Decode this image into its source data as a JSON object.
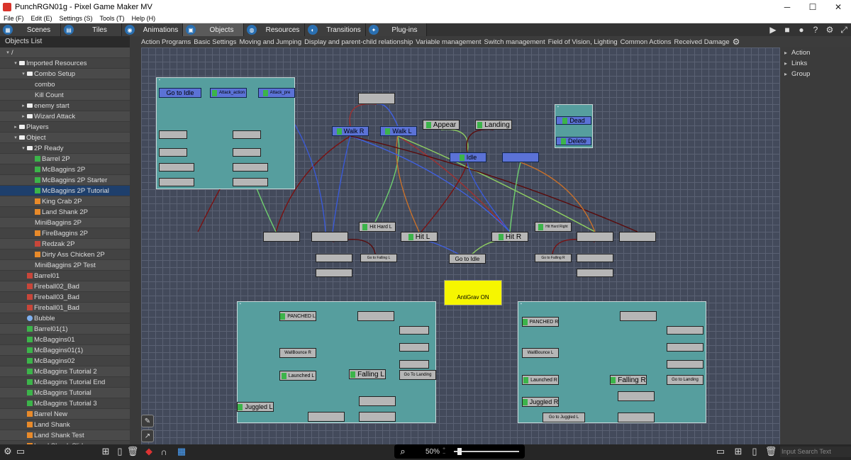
{
  "window": {
    "title": "PunchRGN01g - Pixel Game Maker MV",
    "minimize": "─",
    "maximize": "☐",
    "close": "✕"
  },
  "menu": [
    "File (F)",
    "Edit (E)",
    "Settings (S)",
    "Tools (T)",
    "Help (H)"
  ],
  "tabs": [
    {
      "label": "Scenes",
      "icon": "scenes-icon"
    },
    {
      "label": "Tiles",
      "icon": "tiles-icon"
    },
    {
      "label": "Animations",
      "icon": "animations-icon"
    },
    {
      "label": "Objects",
      "icon": "objects-icon"
    },
    {
      "label": "Resources",
      "icon": "resources-icon"
    },
    {
      "label": "Transitions",
      "icon": "transitions-icon"
    },
    {
      "label": "Plug-ins",
      "icon": "plugins-icon"
    }
  ],
  "toolbar_icons": [
    "play-icon",
    "stop-icon",
    "record-icon",
    "help-icon",
    "settings-icon",
    "fullscreen-icon"
  ],
  "objects_list": {
    "header": "Objects List",
    "items": [
      {
        "label": "/",
        "depth": 0,
        "arrow": "▾",
        "icon": "none"
      },
      {
        "label": "Imported Resources",
        "depth": 1,
        "arrow": "▾",
        "icon": "folder"
      },
      {
        "label": "Combo Setup",
        "depth": 2,
        "arrow": "▾",
        "icon": "folder"
      },
      {
        "label": "combo",
        "depth": 3,
        "arrow": "",
        "icon": "none"
      },
      {
        "label": "Kill Count",
        "depth": 3,
        "arrow": "",
        "icon": "none"
      },
      {
        "label": "enemy start",
        "depth": 2,
        "arrow": "▸",
        "icon": "folder"
      },
      {
        "label": "Wizard Attack",
        "depth": 2,
        "arrow": "▸",
        "icon": "folder"
      },
      {
        "label": "Players",
        "depth": 1,
        "arrow": "▸",
        "icon": "folder"
      },
      {
        "label": "Object",
        "depth": 1,
        "arrow": "▾",
        "icon": "folder"
      },
      {
        "label": "2P Ready",
        "depth": 2,
        "arrow": "▾",
        "icon": "folder"
      },
      {
        "label": "Barrel 2P",
        "depth": 3,
        "arrow": "",
        "icon": "green"
      },
      {
        "label": "McBaggins 2P",
        "depth": 3,
        "arrow": "",
        "icon": "green"
      },
      {
        "label": "McBaggins 2P Starter",
        "depth": 3,
        "arrow": "",
        "icon": "green"
      },
      {
        "label": "McBaggins 2P Tutorial",
        "depth": 3,
        "arrow": "",
        "icon": "green",
        "selected": true
      },
      {
        "label": "King Crab 2P",
        "depth": 3,
        "arrow": "",
        "icon": "orange"
      },
      {
        "label": "Land Shank 2P",
        "depth": 3,
        "arrow": "",
        "icon": "orange"
      },
      {
        "label": "MiniBaggins 2P",
        "depth": 3,
        "arrow": "",
        "icon": "none"
      },
      {
        "label": "FireBaggins 2P",
        "depth": 3,
        "arrow": "",
        "icon": "orange"
      },
      {
        "label": "Redzak 2P",
        "depth": 3,
        "arrow": "",
        "icon": "red"
      },
      {
        "label": "Dirty Ass Chicken 2P",
        "depth": 3,
        "arrow": "",
        "icon": "orange"
      },
      {
        "label": "MiniBaggins 2P Test",
        "depth": 3,
        "arrow": "",
        "icon": "none"
      },
      {
        "label": "Barrel01",
        "depth": 2,
        "arrow": "",
        "icon": "red"
      },
      {
        "label": "Fireball02_Bad",
        "depth": 2,
        "arrow": "",
        "icon": "red"
      },
      {
        "label": "Fireball03_Bad",
        "depth": 2,
        "arrow": "",
        "icon": "red"
      },
      {
        "label": "Fireball01_Bad",
        "depth": 2,
        "arrow": "",
        "icon": "red"
      },
      {
        "label": "Bubble",
        "depth": 2,
        "arrow": "",
        "icon": "blue"
      },
      {
        "label": "Barrel01(1)",
        "depth": 2,
        "arrow": "",
        "icon": "green"
      },
      {
        "label": "McBaggins01",
        "depth": 2,
        "arrow": "",
        "icon": "green"
      },
      {
        "label": "McBaggins01(1)",
        "depth": 2,
        "arrow": "",
        "icon": "green"
      },
      {
        "label": "McBaggins02",
        "depth": 2,
        "arrow": "",
        "icon": "green"
      },
      {
        "label": "McBaggins Tutorial 2",
        "depth": 2,
        "arrow": "",
        "icon": "green"
      },
      {
        "label": "McBaggins Tutorial End",
        "depth": 2,
        "arrow": "",
        "icon": "green"
      },
      {
        "label": "McBaggins Tutorial",
        "depth": 2,
        "arrow": "",
        "icon": "green"
      },
      {
        "label": "McBaggins Tutorial 3",
        "depth": 2,
        "arrow": "",
        "icon": "green"
      },
      {
        "label": "Barrel New",
        "depth": 2,
        "arrow": "",
        "icon": "orange"
      },
      {
        "label": "Land Shank",
        "depth": 2,
        "arrow": "",
        "icon": "orange"
      },
      {
        "label": "Land Shank Test",
        "depth": 2,
        "arrow": "",
        "icon": "orange"
      },
      {
        "label": "Land Shank Slide",
        "depth": 2,
        "arrow": "",
        "icon": "orange"
      }
    ]
  },
  "property_tabs": [
    "Action Programs",
    "Basic Settings",
    "Moving and Jumping",
    "Display and parent-child relationship",
    "Variable management",
    "Switch management",
    "Field of Vision, Lighting",
    "Common Actions",
    "Received Damage"
  ],
  "right_panel": [
    "Action",
    "Links",
    "Group"
  ],
  "zoom": {
    "value": "50%",
    "level_fraction": 0.05
  },
  "search": {
    "placeholder": "Input Search Text"
  },
  "nodes": {
    "go_to_idle": "Go to Idle",
    "attack_action": "Attack_action",
    "attack_pre": "Attack_pre",
    "walk_r": "Walk R",
    "walk_l": "Walk L",
    "appear": "Appear",
    "landing": "Landing",
    "idle": "Idle",
    "dead": "Dead",
    "delete": "Delete",
    "hit_hard_l": "Hit Hard L",
    "hit_l": "Hit L",
    "hit_r": "Hit R",
    "hit_hard_right": "Hit Hard Right",
    "go_to_idle_2": "Go to Idle",
    "go_to_falling_l": "Go to Falling L",
    "go_to_falling_r": "Go to Falling R",
    "antigrav_on": "AntiGrav  ON",
    "punched_l": "PANCHED L",
    "punched_r": "PANCHED R",
    "launched_l": "Launched L",
    "launched_r": "Launched R",
    "falling_l": "Falling L",
    "falling_r": "Falling R",
    "juggled_l": "Juggled L",
    "juggled_r": "Juggled R",
    "go_to_landing_l": "Go To Landing",
    "go_to_landing_r": "Go to Landing",
    "go_to_juggled_l": "Go to Juggled L",
    "wallbounce_r": "WallBounce R",
    "wallbounce_l": "WallBounce L"
  },
  "colors": {
    "canvas": "#434a5b",
    "group": "#569e9e",
    "state_node": "#5b72d6",
    "gray_node": "#b6b6b6",
    "selected": "#1e3f6c",
    "highlight_node": "#f6f600"
  }
}
